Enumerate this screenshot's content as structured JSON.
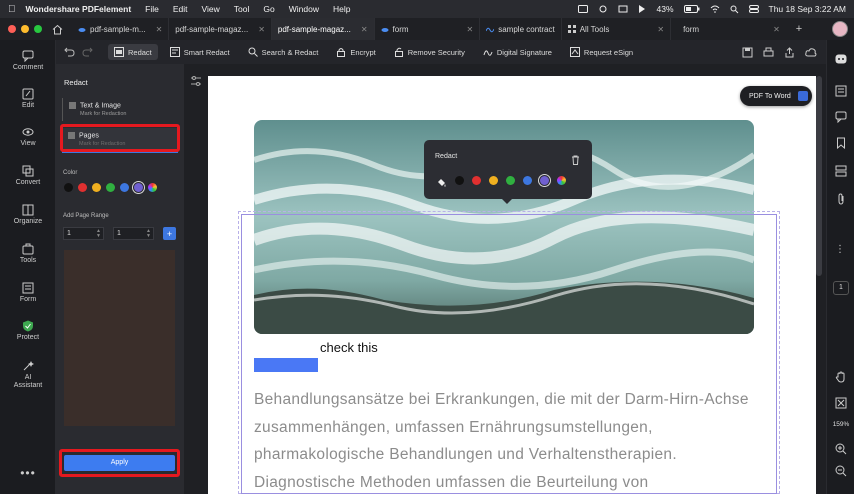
{
  "menubar": {
    "app_name": "Wondershare PDFelement",
    "items": [
      "File",
      "Edit",
      "View",
      "Tool",
      "Go",
      "Window",
      "Help"
    ],
    "battery": "43%",
    "datetime": "Thu 18 Sep 3:22 AM"
  },
  "tabs": [
    {
      "label": "pdf-sample-m...",
      "active": false
    },
    {
      "label": "pdf-sample-magaz...",
      "active": false
    },
    {
      "label": "pdf-sample-magaz...",
      "active": true
    },
    {
      "label": "form",
      "active": false
    },
    {
      "label": "sample contract",
      "active": false
    },
    {
      "label": "All Tools",
      "active": false
    },
    {
      "label": "form",
      "active": false
    }
  ],
  "rail": {
    "items": [
      {
        "label": "Comment",
        "icon": "comment-icon"
      },
      {
        "label": "Edit",
        "icon": "edit-icon"
      },
      {
        "label": "View",
        "icon": "eye-icon"
      },
      {
        "label": "Convert",
        "icon": "convert-icon"
      },
      {
        "label": "Organize",
        "icon": "organize-icon"
      },
      {
        "label": "Tools",
        "icon": "toolbox-icon"
      },
      {
        "label": "Form",
        "icon": "form-icon"
      },
      {
        "label": "Protect",
        "icon": "shield-icon"
      },
      {
        "label": "AI Assistant",
        "icon": "ai-icon"
      }
    ]
  },
  "toolbar": {
    "items": [
      {
        "label": "Redact",
        "icon": "redact-icon",
        "active": true
      },
      {
        "label": "Smart Redact",
        "icon": "smart-redact-icon",
        "active": false
      },
      {
        "label": "Search & Redact",
        "icon": "search-redact-icon",
        "active": false
      },
      {
        "label": "Encrypt",
        "icon": "lock-icon",
        "active": false
      },
      {
        "label": "Remove Security",
        "icon": "unlock-icon",
        "active": false
      },
      {
        "label": "Digital Signature",
        "icon": "signature-icon",
        "active": false
      },
      {
        "label": "Request eSign",
        "icon": "esign-icon",
        "active": false
      }
    ]
  },
  "panel": {
    "title": "Redact",
    "text_image": {
      "label": "Text & Image",
      "sub": "Mark for Redaction"
    },
    "pages": {
      "label": "Pages",
      "sub": "Mark for Redaction"
    },
    "color_label": "Color",
    "colors": [
      "#111111",
      "#e03030",
      "#f0b020",
      "#30b040",
      "#3d77e0",
      "#7060d0",
      "rainbow"
    ],
    "selected_color_index": 5,
    "range_label": "Add Page Range",
    "range_from": "1",
    "range_to": "1",
    "apply_label": "Apply"
  },
  "document": {
    "check_text": "check this",
    "body_lines": [
      "Behandlungsansätze bei Erkrankungen, die mit der Darm-Hirn-Achse",
      "zusammenhängen, umfassen Ernährungsumstellungen,",
      "pharmakologische Behandlungen und Verhaltenstherapien.",
      "Diagnostische Methoden umfassen die Beurteilung von"
    ]
  },
  "popup": {
    "title": "Redact",
    "colors": [
      "#111111",
      "#e03030",
      "#f0b020",
      "#30b040",
      "#3d77e0",
      "#7060d0",
      "rainbow"
    ],
    "selected_color_index": 5
  },
  "tip": {
    "label": "PDF To Word"
  },
  "right_rail": {
    "page_number": "1",
    "zoom": "159%"
  }
}
